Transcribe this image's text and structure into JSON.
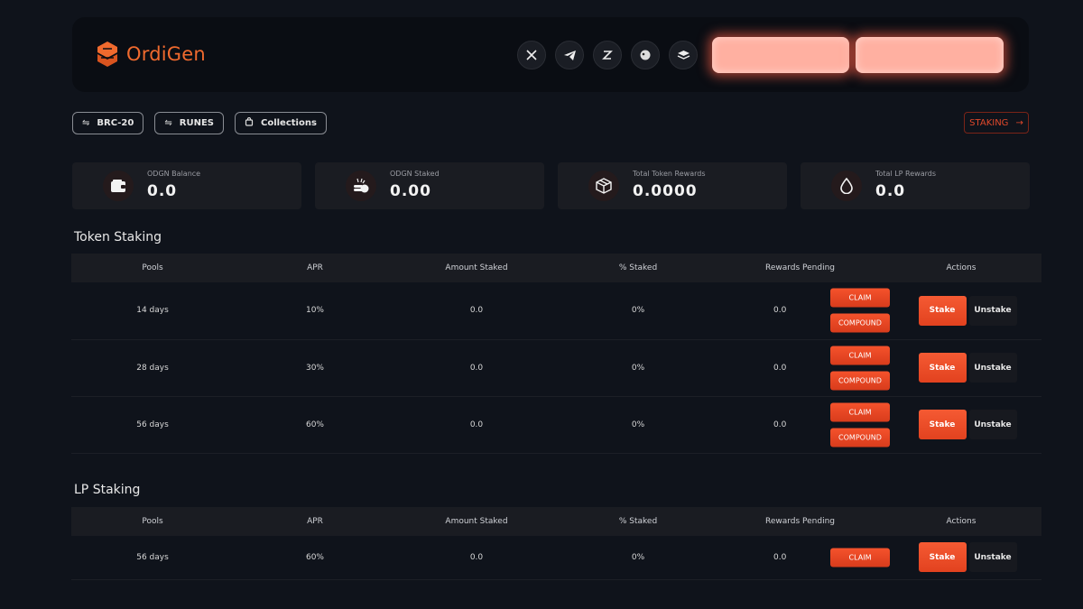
{
  "brand": {
    "name": "OrdiGen",
    "accent": "#f06a2e"
  },
  "header": {
    "socials": [
      {
        "icon": "x-icon"
      },
      {
        "icon": "telegram-icon"
      },
      {
        "icon": "dextools-icon"
      },
      {
        "icon": "coingecko-icon"
      },
      {
        "icon": "docs-icon"
      }
    ],
    "buttons": [
      "",
      ""
    ]
  },
  "nav": {
    "chips": [
      {
        "icon": "swap-icon",
        "label": "BRC-20"
      },
      {
        "icon": "swap-icon",
        "label": "RUNES"
      },
      {
        "icon": "bag-icon",
        "label": "Collections"
      }
    ],
    "staking_label": "STAKING"
  },
  "stats": [
    {
      "icon": "wallet-icon",
      "label": "ODGN Balance",
      "value": "0.0"
    },
    {
      "icon": "coins-icon",
      "label": "ODGN Staked",
      "value": "0.00"
    },
    {
      "icon": "box-icon",
      "label": "Total Token Rewards",
      "value": "0.0000"
    },
    {
      "icon": "drop-icon",
      "label": "Total LP Rewards",
      "value": "0.0"
    }
  ],
  "token_staking": {
    "title": "Token Staking",
    "columns": [
      "Pools",
      "APR",
      "Amount Staked",
      "% Staked",
      "Rewards Pending",
      "Actions"
    ],
    "rows": [
      {
        "pool": "14 days",
        "apr": "10%",
        "amount": "0.0",
        "pct": "0%",
        "rewards": "0.0"
      },
      {
        "pool": "28 days",
        "apr": "30%",
        "amount": "0.0",
        "pct": "0%",
        "rewards": "0.0"
      },
      {
        "pool": "56 days",
        "apr": "60%",
        "amount": "0.0",
        "pct": "0%",
        "rewards": "0.0"
      }
    ]
  },
  "lp_staking": {
    "title": "LP Staking",
    "columns": [
      "Pools",
      "APR",
      "Amount Staked",
      "% Staked",
      "Rewards Pending",
      "Actions"
    ],
    "rows": [
      {
        "pool": "56 days",
        "apr": "60%",
        "amount": "0.0",
        "pct": "0%",
        "rewards": "0.0"
      }
    ]
  },
  "actions": {
    "claim": "CLAIM",
    "compound": "COMPOUND",
    "stake": "Stake",
    "unstake": "Unstake"
  }
}
